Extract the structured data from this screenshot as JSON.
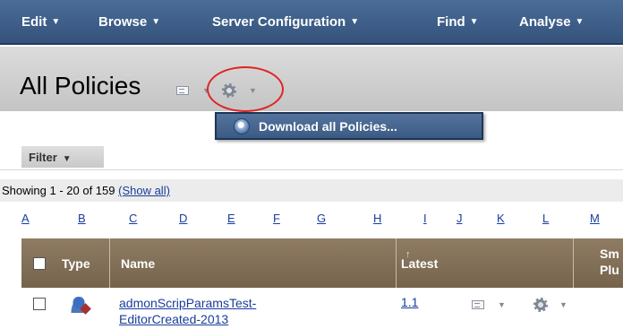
{
  "topnav": {
    "items": [
      {
        "label": "Edit",
        "caret": "▼"
      },
      {
        "label": "Browse",
        "caret": "▼"
      },
      {
        "label": "Server Configuration",
        "caret": "▼"
      },
      {
        "label": "Find",
        "caret": "▼"
      },
      {
        "label": "Analyse",
        "caret": "▼"
      }
    ],
    "icons": {
      "caret": "chevron-down-icon"
    }
  },
  "page": {
    "title": "All Policies"
  },
  "menu": {
    "download_label": "Download all Policies..."
  },
  "filter": {
    "label": "Filter",
    "caret": "▼"
  },
  "showing": {
    "text": "Showing 1 - 20 of 159",
    "show_all": "(Show all)"
  },
  "alphabet": [
    "A",
    "B",
    "C",
    "D",
    "E",
    "F",
    "G",
    "H",
    "I",
    "J",
    "K",
    "L",
    "M"
  ],
  "table": {
    "headers": {
      "type": "Type",
      "name": "Name",
      "latest": "Latest",
      "sm_top": "Sm",
      "sm_bottom": "Plu"
    },
    "sort_indicator": "↑",
    "rows": [
      {
        "name_line1": "admonScripParamsTest-",
        "name_line2": "EditorCreated-2013",
        "version": "1.1"
      }
    ]
  },
  "colors": {
    "nav_bg": "#3f5f8a",
    "title_band": "#d0d0d0",
    "table_header": "#806d55",
    "link": "#1a3d9b",
    "highlight_circle": "#e02424"
  }
}
